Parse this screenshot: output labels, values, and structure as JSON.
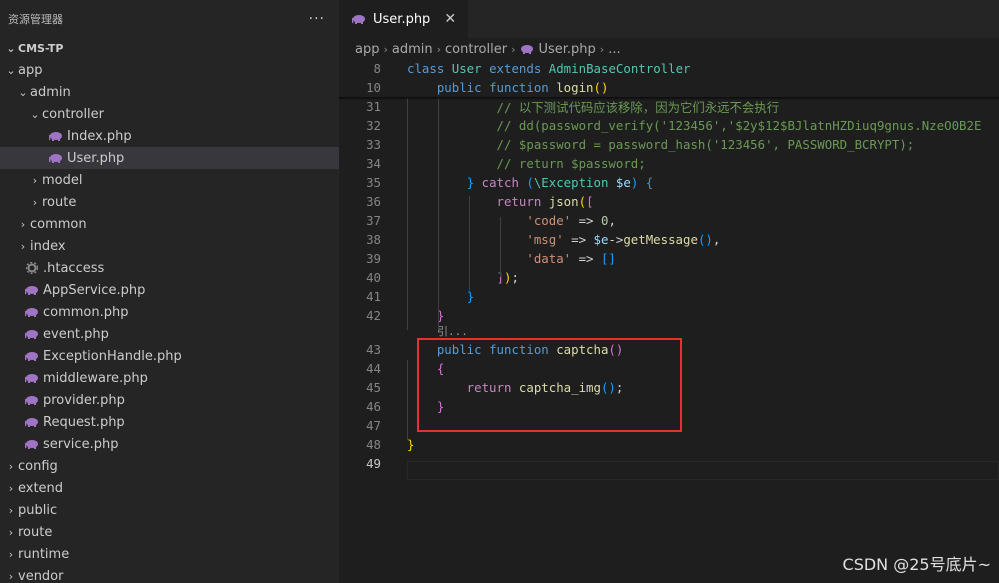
{
  "sidebar": {
    "title": "资源管理器",
    "more_label": "···",
    "tree": [
      {
        "label": "CMS-TP",
        "indent": 0,
        "type": "project",
        "twisty": "⌄"
      },
      {
        "label": "app",
        "indent": 0,
        "type": "folder",
        "twisty": "⌄"
      },
      {
        "label": "admin",
        "indent": 1,
        "type": "folder",
        "twisty": "⌄"
      },
      {
        "label": "controller",
        "indent": 2,
        "type": "folder",
        "twisty": "⌄"
      },
      {
        "label": "Index.php",
        "indent": 3,
        "type": "php"
      },
      {
        "label": "User.php",
        "indent": 3,
        "type": "php",
        "active": true
      },
      {
        "label": "model",
        "indent": 2,
        "type": "folder",
        "twisty": "›"
      },
      {
        "label": "route",
        "indent": 2,
        "type": "folder",
        "twisty": "›"
      },
      {
        "label": "common",
        "indent": 1,
        "type": "folder",
        "twisty": "›"
      },
      {
        "label": "index",
        "indent": 1,
        "type": "folder",
        "twisty": "›"
      },
      {
        "label": ".htaccess",
        "indent": 1,
        "type": "config"
      },
      {
        "label": "AppService.php",
        "indent": 1,
        "type": "php"
      },
      {
        "label": "common.php",
        "indent": 1,
        "type": "php"
      },
      {
        "label": "event.php",
        "indent": 1,
        "type": "php"
      },
      {
        "label": "ExceptionHandle.php",
        "indent": 1,
        "type": "php"
      },
      {
        "label": "middleware.php",
        "indent": 1,
        "type": "php"
      },
      {
        "label": "provider.php",
        "indent": 1,
        "type": "php"
      },
      {
        "label": "Request.php",
        "indent": 1,
        "type": "php"
      },
      {
        "label": "service.php",
        "indent": 1,
        "type": "php"
      },
      {
        "label": "config",
        "indent": 0,
        "type": "folder",
        "twisty": "›"
      },
      {
        "label": "extend",
        "indent": 0,
        "type": "folder",
        "twisty": "›"
      },
      {
        "label": "public",
        "indent": 0,
        "type": "folder",
        "twisty": "›"
      },
      {
        "label": "route",
        "indent": 0,
        "type": "folder",
        "twisty": "›"
      },
      {
        "label": "runtime",
        "indent": 0,
        "type": "folder",
        "twisty": "›"
      },
      {
        "label": "vendor",
        "indent": 0,
        "type": "folder",
        "twisty": "›"
      }
    ]
  },
  "tab": {
    "label": "User.php",
    "close_label": "✕"
  },
  "breadcrumb": [
    "app",
    "admin",
    "controller",
    "User.php",
    "..."
  ],
  "code_lens": "引...",
  "code_lines": [
    {
      "n": "8",
      "sticky": true,
      "tokens": [
        [
          "class ",
          "kw"
        ],
        [
          "User ",
          "cls"
        ],
        [
          "extends ",
          "kw"
        ],
        [
          "AdminBaseController",
          "cls"
        ]
      ]
    },
    {
      "n": "10",
      "sticky": true,
      "tokens": [
        [
          "    public ",
          "kw"
        ],
        [
          "function ",
          "kw"
        ],
        [
          "login",
          "fn"
        ],
        [
          "()",
          "p1"
        ]
      ]
    },
    {
      "n": "31",
      "tokens": [
        [
          "            // 以下测试代码应该移除，因为它们永远不会执行",
          "cm"
        ]
      ]
    },
    {
      "n": "32",
      "tokens": [
        [
          "            // dd(password_verify('123456','$2y$12$BJlatnHZDiuq9gnus.NzeO0B2E",
          "cm"
        ]
      ]
    },
    {
      "n": "33",
      "tokens": [
        [
          "            // $password = password_hash('123456', PASSWORD_BCRYPT);",
          "cm"
        ]
      ]
    },
    {
      "n": "34",
      "tokens": [
        [
          "            // return $password;",
          "cm"
        ]
      ]
    },
    {
      "n": "35",
      "tokens": [
        [
          "        ",
          "op"
        ],
        [
          "}",
          "p3"
        ],
        [
          " catch ",
          "ctl"
        ],
        [
          "(",
          "p3"
        ],
        [
          "\\Exception ",
          "cls"
        ],
        [
          "$e",
          "vr"
        ],
        [
          ") ",
          "p3"
        ],
        [
          "{",
          "p3"
        ]
      ]
    },
    {
      "n": "36",
      "tokens": [
        [
          "            return ",
          "ctl"
        ],
        [
          "json",
          "fn"
        ],
        [
          "(",
          "p1"
        ],
        [
          "[",
          "p2"
        ]
      ]
    },
    {
      "n": "37",
      "tokens": [
        [
          "                'code'",
          "str"
        ],
        [
          " => ",
          "op"
        ],
        [
          "0",
          "num"
        ],
        [
          ",",
          "op"
        ]
      ]
    },
    {
      "n": "38",
      "tokens": [
        [
          "                'msg'",
          "str"
        ],
        [
          " => ",
          "op"
        ],
        [
          "$e",
          "vr"
        ],
        [
          "->",
          "op"
        ],
        [
          "getMessage",
          "fn"
        ],
        [
          "()",
          "p3"
        ],
        [
          ",",
          "op"
        ]
      ]
    },
    {
      "n": "39",
      "tokens": [
        [
          "                'data'",
          "str"
        ],
        [
          " => ",
          "op"
        ],
        [
          "[]",
          "p3"
        ]
      ]
    },
    {
      "n": "40",
      "tokens": [
        [
          "            ",
          "op"
        ],
        [
          "]",
          "p2"
        ],
        [
          ")",
          "p1"
        ],
        [
          ";",
          "op"
        ]
      ]
    },
    {
      "n": "41",
      "tokens": [
        [
          "        ",
          "op"
        ],
        [
          "}",
          "p3"
        ]
      ]
    },
    {
      "n": "42",
      "tokens": [
        [
          "    ",
          "op"
        ],
        [
          "}",
          "p2"
        ]
      ]
    },
    {
      "n": "43",
      "lens": true,
      "tokens": [
        [
          "    public ",
          "kw"
        ],
        [
          "function ",
          "kw"
        ],
        [
          "captcha",
          "fn"
        ],
        [
          "()",
          "p2"
        ]
      ]
    },
    {
      "n": "44",
      "tokens": [
        [
          "    ",
          "op"
        ],
        [
          "{",
          "p2"
        ]
      ]
    },
    {
      "n": "45",
      "tokens": [
        [
          "        return ",
          "ctl"
        ],
        [
          "captcha_img",
          "fn"
        ],
        [
          "()",
          "p3"
        ],
        [
          ";",
          "op"
        ]
      ]
    },
    {
      "n": "46",
      "tokens": [
        [
          "    ",
          "op"
        ],
        [
          "}",
          "p2"
        ]
      ]
    },
    {
      "n": "47",
      "tokens": []
    },
    {
      "n": "48",
      "tokens": [
        [
          "}",
          "p1"
        ]
      ]
    },
    {
      "n": "49",
      "current": true,
      "tokens": []
    }
  ],
  "watermark": "CSDN @25号底片~",
  "colors": {
    "background": "#1e1e1e",
    "sidebar": "#252526",
    "highlight_box": "#e8312f",
    "php_icon": "#a074c4"
  }
}
